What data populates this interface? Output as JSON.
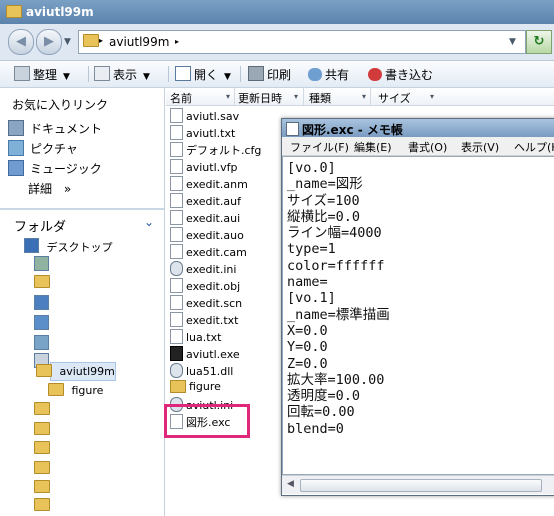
{
  "window": {
    "title": "aviutl99m"
  },
  "address": {
    "path": "aviutl99m",
    "back_label": "◀",
    "forward_label": "▶"
  },
  "toolbar": {
    "organize": "整理",
    "view": "表示",
    "open": "開く",
    "print": "印刷",
    "share": "共有",
    "burn": "書き込む"
  },
  "left_pane": {
    "favorites_header": "お気に入りリンク",
    "favorites": [
      "ドキュメント",
      "ピクチャ",
      "ミュージック"
    ],
    "more": "詳細",
    "more_chevron": "»",
    "folders_header": "フォルダ",
    "desktop": "デスクトップ",
    "selected_folder": "aviutl99m",
    "subfolder": "figure"
  },
  "columns": {
    "name": "名前",
    "date": "更新日時",
    "type": "種類",
    "size": "サイズ"
  },
  "files": [
    {
      "name": "aviutl.sav",
      "icon": "document-icon"
    },
    {
      "name": "aviutl.txt",
      "icon": "document-icon"
    },
    {
      "name": "デフォルト.cfg",
      "icon": "document-icon"
    },
    {
      "name": "aviutl.vfp",
      "icon": "document-icon"
    },
    {
      "name": "exedit.anm",
      "icon": "document-icon"
    },
    {
      "name": "exedit.auf",
      "icon": "document-icon"
    },
    {
      "name": "exedit.aui",
      "icon": "document-icon"
    },
    {
      "name": "exedit.auo",
      "icon": "document-icon"
    },
    {
      "name": "exedit.cam",
      "icon": "document-icon"
    },
    {
      "name": "exedit.ini",
      "icon": "settings-file-icon"
    },
    {
      "name": "exedit.obj",
      "icon": "document-icon"
    },
    {
      "name": "exedit.scn",
      "icon": "document-icon"
    },
    {
      "name": "exedit.txt",
      "icon": "document-icon"
    },
    {
      "name": "lua.txt",
      "icon": "document-icon"
    },
    {
      "name": "aviutl.exe",
      "icon": "exe-icon"
    },
    {
      "name": "lua51.dll",
      "icon": "dll-icon"
    },
    {
      "name": "figure",
      "icon": "folder-icon"
    },
    {
      "name": "aviutl.ini",
      "icon": "settings-file-icon"
    },
    {
      "name": "図形.exc",
      "icon": "document-icon"
    }
  ],
  "notepad": {
    "title": "図形.exc - メモ帳",
    "menu": [
      "ファイル(F)",
      "編集(E)",
      "書式(O)",
      "表示(V)",
      "ヘルプ(H)"
    ],
    "content": "[vo.0]\n_name=図形\nサイズ=100\n縦横比=0.0\nライン幅=4000\ntype=1\ncolor=ffffff\nname=\n[vo.1]\n_name=標準描画\nX=0.0\nY=0.0\nZ=0.0\n拡大率=100.00\n透明度=0.0\n回転=0.00\nblend=0"
  },
  "colors": {
    "highlight": "#e0287a",
    "titlebar": "#5b83ad"
  }
}
